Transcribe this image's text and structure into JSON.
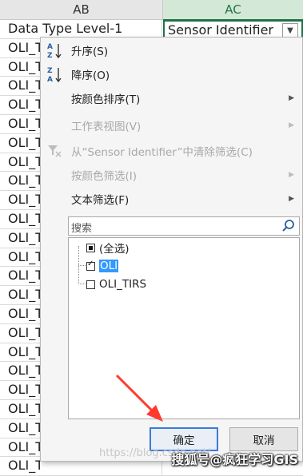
{
  "columns": {
    "left": "AB",
    "right": "AC"
  },
  "header_row": {
    "left": "Data Type Level-1",
    "right": "Sensor Identifier",
    "dropdown_glyph": "▼"
  },
  "cell_prefix": "OLI_T",
  "rows_visible": 23,
  "menu": {
    "items": [
      {
        "label": "升序(S)",
        "icon": "sort-ascending-icon",
        "disabled": false,
        "submenu": false
      },
      {
        "label": "降序(O)",
        "icon": "sort-descending-icon",
        "disabled": false,
        "submenu": false
      },
      {
        "label": "按颜色排序(T)",
        "icon": "",
        "disabled": false,
        "submenu": true
      },
      {
        "label": "工作表视图(V)",
        "icon": "",
        "disabled": true,
        "submenu": true
      },
      {
        "label": "从“Sensor Identifier”中清除筛选(C)",
        "icon": "clear-filter-icon",
        "disabled": true,
        "submenu": false
      },
      {
        "label": "按颜色筛选(I)",
        "icon": "",
        "disabled": true,
        "submenu": true
      },
      {
        "label": "文本筛选(F)",
        "icon": "",
        "disabled": false,
        "submenu": true
      }
    ],
    "submenu_arrow": "▶",
    "search_placeholder": "搜索",
    "options": [
      {
        "label": "(全选)",
        "state": "partial"
      },
      {
        "label": "OLI",
        "state": "checked"
      },
      {
        "label": "OLI_TIRS",
        "state": "unchecked"
      }
    ],
    "ok_label": "确定",
    "cancel_label": "取消"
  },
  "overlay_text": {
    "watermark": "https://blog.csdn.net/",
    "credit": "搜狐号@疯狂学习GIS"
  },
  "colors": {
    "accent": "#217346",
    "highlight": "#3399ff",
    "arrow": "#ff3b30"
  }
}
